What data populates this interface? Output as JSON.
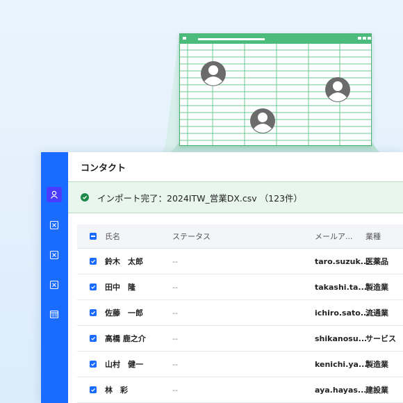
{
  "app": {
    "page_title": "コンタクト",
    "banner_text": "インポート完了：2024ITW_営業DX.csv （123件）"
  },
  "sidebar": {
    "items": [
      {
        "icon": "contact-icon",
        "active": true
      },
      {
        "icon": "close-box-icon",
        "active": false
      },
      {
        "icon": "close-box-icon",
        "active": false
      },
      {
        "icon": "close-box-icon",
        "active": false
      },
      {
        "icon": "calendar-icon",
        "active": false
      }
    ]
  },
  "table": {
    "headers": {
      "name": "氏名",
      "status": "ステータス",
      "email": "メールア...",
      "industry": "業種"
    },
    "rows": [
      {
        "name": "鈴木　太郎",
        "status": "--",
        "email": "taro.suzuk...",
        "industry": "医薬品"
      },
      {
        "name": "田中　隆",
        "status": "--",
        "email": "takashi.ta...",
        "industry": "製造業"
      },
      {
        "name": "佐藤　一郎",
        "status": "--",
        "email": "ichiro.sato...",
        "industry": "流通業"
      },
      {
        "name": "高橋 鹿之介",
        "status": "--",
        "email": "shikanosu...",
        "industry": "サービス"
      },
      {
        "name": "山村　健一",
        "status": "--",
        "email": "kenichi.ya...",
        "industry": "製造業"
      },
      {
        "name": "林　彩",
        "status": "--",
        "email": "aya.hayas...",
        "industry": "建設業"
      }
    ]
  },
  "colors": {
    "accent": "#1a6bff",
    "success": "#1d8a4a",
    "sheet_green": "#4cbc7c"
  }
}
